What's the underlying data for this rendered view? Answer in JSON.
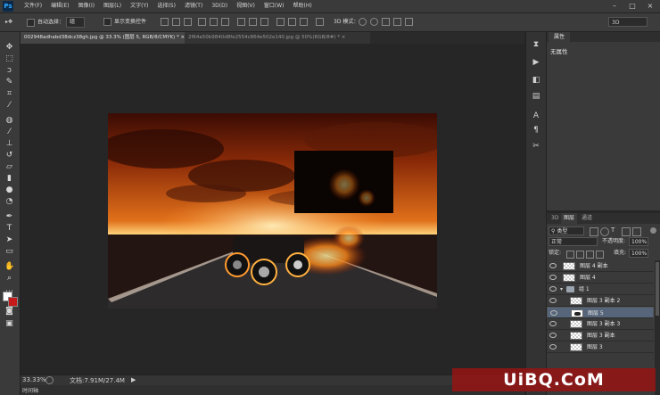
{
  "app": {
    "logo": "Ps"
  },
  "menu": [
    "文件(F)",
    "编辑(E)",
    "图像(I)",
    "图层(L)",
    "文字(Y)",
    "选择(S)",
    "滤镜(T)",
    "3D(D)",
    "视图(V)",
    "窗口(W)",
    "帮助(H)"
  ],
  "window_controls": {
    "minimize": "–",
    "restore": "□",
    "close": "×"
  },
  "options": {
    "auto_select_label": "自动选择：",
    "auto_select_value": "组",
    "show_transform_label": "显示变换控件",
    "mode3d_label": "3D 模式：",
    "workspace_value": "3D"
  },
  "tabs": [
    {
      "label": "002948adhabd38dcz38gh.jpg @ 33.3% (图层 5, RGB/8/CMYK) *",
      "close": "×"
    },
    {
      "label": "2f64a50b9840d8fe2554c864e502e140.jpg @ 50%(RGB/8#) *",
      "close": "×"
    }
  ],
  "status": {
    "zoom": "33.33%",
    "doc_info": "文档:7.91M/27.4M",
    "arrow": "▶"
  },
  "timeline_label": "时间轴",
  "properties": {
    "tab": "属性",
    "empty_text": "无属性"
  },
  "layers_panel": {
    "tabs": [
      "3D",
      "图层",
      "通道"
    ],
    "filter_kind": "类型",
    "blend_mode": "正常",
    "opacity_label": "不透明度:",
    "opacity_value": "100%",
    "lock_label": "锁定:",
    "fill_label": "填充:",
    "fill_value": "100%",
    "layers": [
      {
        "name": "图层 4 副本",
        "type": "layer",
        "selected": false
      },
      {
        "name": "图层 4",
        "type": "layer",
        "selected": false
      },
      {
        "name": "组 1",
        "type": "group",
        "selected": false
      },
      {
        "name": "图层 3 副本 2",
        "type": "layer",
        "selected": false
      },
      {
        "name": "图层 5",
        "type": "layer",
        "selected": true
      },
      {
        "name": "图层 3 副本 3",
        "type": "layer",
        "selected": false
      },
      {
        "name": "图层 3 副本",
        "type": "layer",
        "selected": false
      },
      {
        "name": "图层 3",
        "type": "layer",
        "selected": false
      }
    ]
  },
  "watermark": "UiBQ.CoM",
  "icons": {
    "tools": [
      "move-icon",
      "marquee-icon",
      "lasso-icon",
      "quick-select-icon",
      "crop-icon",
      "eyedropper-icon",
      "healing-icon",
      "brush-icon",
      "stamp-icon",
      "history-brush-icon",
      "eraser-icon",
      "gradient-icon",
      "blur-icon",
      "dodge-icon",
      "pen-icon",
      "type-icon",
      "path-select-icon",
      "shape-icon",
      "hand-icon",
      "zoom-icon"
    ],
    "dock": [
      "history-icon",
      "actions-icon",
      "adjustments-icon",
      "styles-icon",
      "character-icon",
      "paragraph-icon",
      "tool-presets-icon"
    ]
  }
}
